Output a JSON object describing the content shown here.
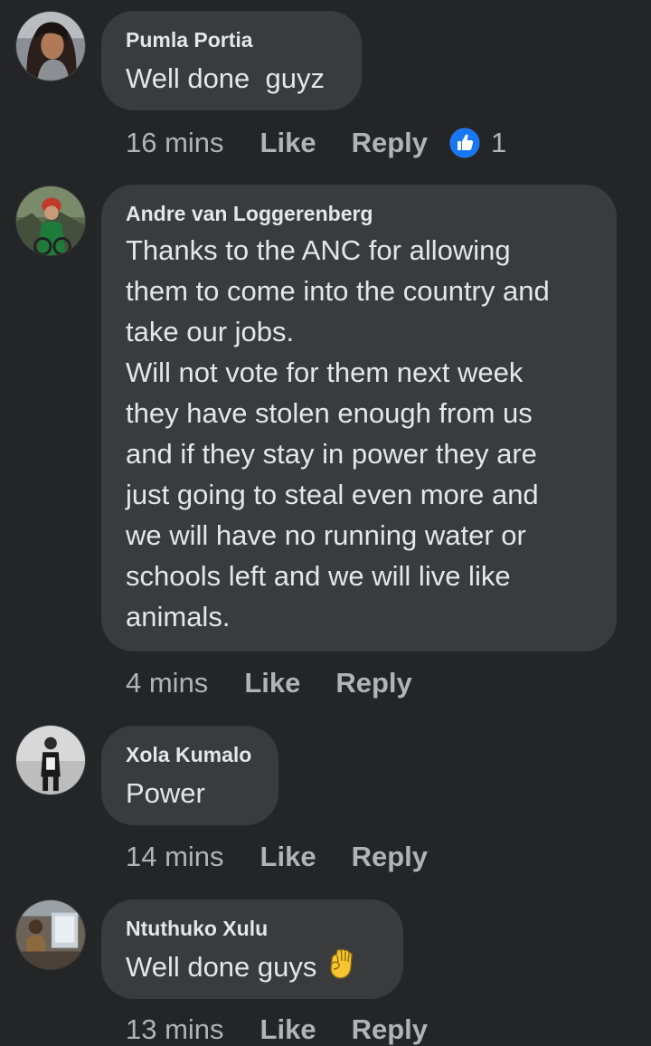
{
  "comments": [
    {
      "author": "Pumla Portia",
      "text": "Well done  guyz",
      "time": "16 mins",
      "like_label": "Like",
      "reply_label": "Reply",
      "reaction_icon": "thumbs-up-icon",
      "reaction_count": "1"
    },
    {
      "author": "Andre van Loggerenberg",
      "text": "Thanks to the ANC for allowing\nthem to come into the country and\ntake our jobs.\nWill not vote for them next week\nthey have stolen enough from us\nand if they stay in power they are\njust going to steal even more and\nwe will have no running water or\nschools left and we will live like\nanimals.",
      "time": "4 mins",
      "like_label": "Like",
      "reply_label": "Reply"
    },
    {
      "author": "Xola Kumalo",
      "text": "Power",
      "time": "14 mins",
      "like_label": "Like",
      "reply_label": "Reply"
    },
    {
      "author": "Ntuthuko Xulu",
      "text": "Well done guys",
      "emoji": "raised-fist-icon",
      "time": "13 mins",
      "like_label": "Like",
      "reply_label": "Reply"
    }
  ],
  "colors": {
    "background": "#242526",
    "bubble": "#3a3b3c",
    "text_primary": "#e4e6eb",
    "text_secondary": "#b0b3b8",
    "like_reaction_blue": "#1877f2",
    "fist_yellow": "#f7c531"
  }
}
